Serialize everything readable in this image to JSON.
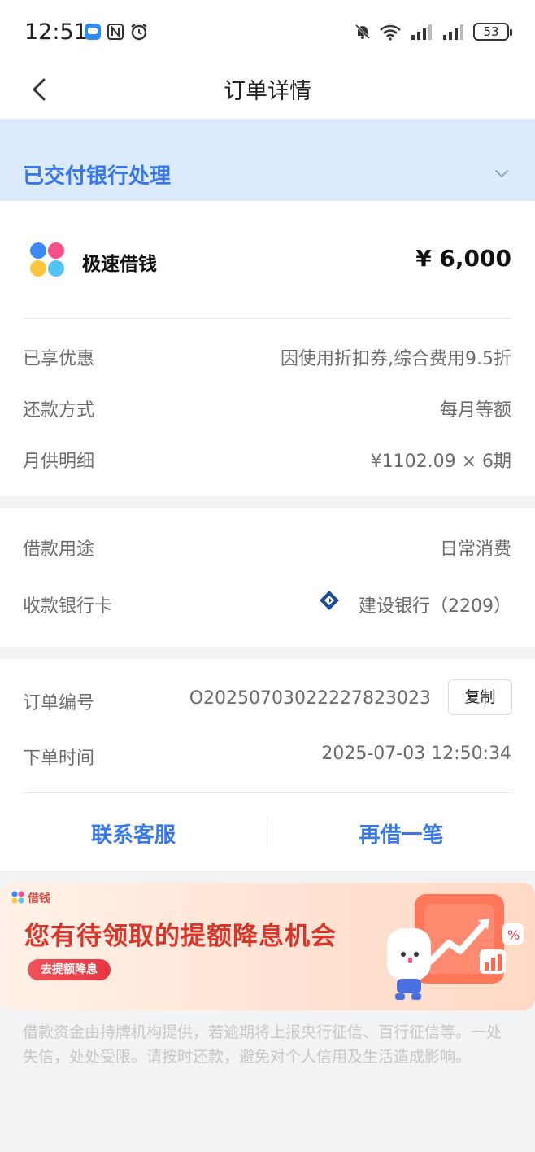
{
  "status_bar": {
    "time": "12:51",
    "battery": "53",
    "icons": [
      "chat-bubble-icon",
      "nfc-icon",
      "alarm-icon",
      "mute-bell-icon",
      "wifi-icon",
      "signal-icon",
      "signal-icon"
    ]
  },
  "nav": {
    "title": "订单详情",
    "back_icon": "chevron-left-icon"
  },
  "order_status": {
    "text": "已交付银行处理",
    "expand_icon": "chevron-down-icon",
    "color": "#3a78e8",
    "bg": "#dcebfc"
  },
  "loan": {
    "app_name": "极速借钱",
    "amount": "¥ 6,000",
    "rows": [
      {
        "label": "已享优惠",
        "value": "因使用折扣券,综合费用9.5折"
      },
      {
        "label": "还款方式",
        "value": "每月等额"
      },
      {
        "label": "月供明细",
        "value": "¥1102.09 × 6期"
      }
    ]
  },
  "usage": {
    "purpose_label": "借款用途",
    "purpose_value": "日常消费",
    "bank_label": "收款银行卡",
    "bank_value": "建设银行（2209）",
    "bank_icon": "ccb-bank-logo-icon"
  },
  "order": {
    "number_label": "订单编号",
    "number_value": "O20250703022227823023",
    "copy_label": "复制",
    "time_label": "下单时间",
    "time_value": "2025-07-03 12:50:34"
  },
  "actions": {
    "contact_label": "联系客服",
    "borrow_again_label": "再借一笔",
    "color": "#3a78e8"
  },
  "promo": {
    "brand": "借钱",
    "title": "您有待领取的提额降息机会",
    "button": "去提额降息"
  },
  "disclaimer": "借款资金由持牌机构提供，若逾期将上报央行征信、百行征信等。一处失信，处处受限。请按时还款，避免对个人信用及生活造成影响。"
}
